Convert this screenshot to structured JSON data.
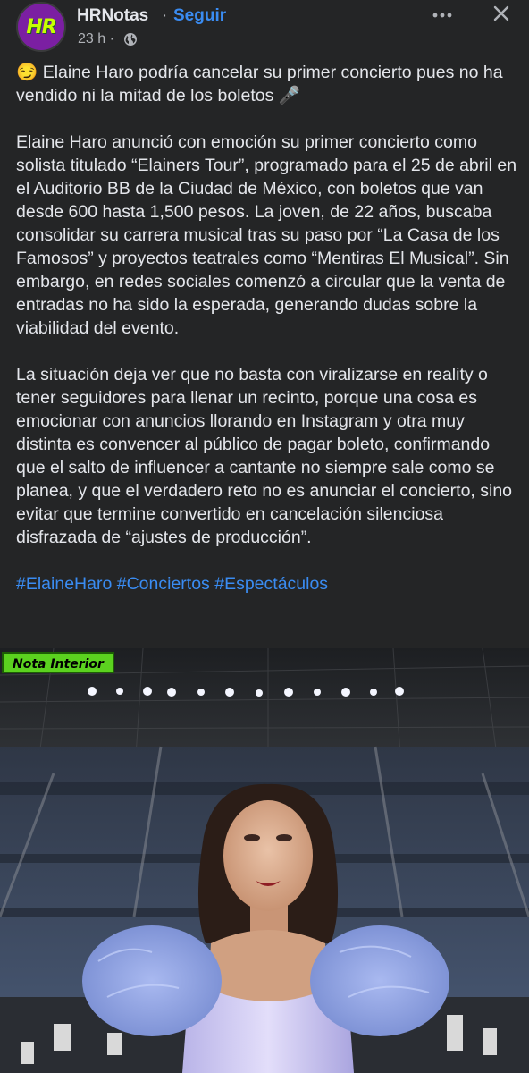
{
  "header": {
    "avatar_text": "HR",
    "page_name": "HRNotas",
    "separator": "·",
    "follow_label": "Seguir",
    "timestamp": "23 h ·",
    "privacy_icon": "globe-icon",
    "more_icon": "more-icon",
    "close_icon": "close-icon"
  },
  "post": {
    "headline": "😏 Elaine Haro podría cancelar su primer concierto pues no ha vendido ni la mitad de los boletos 🎤",
    "paragraph_1": "Elaine Haro anunció con emoción su primer concierto como solista titulado “Elainers Tour”, programado para el 25 de abril en el Auditorio BB de la Ciudad de México, con boletos que van desde 600 hasta 1,500 pesos. La joven, de 22 años, buscaba consolidar su carrera musical tras su paso por “La Casa de los Famosos” y proyectos teatrales como “Mentiras El Musical”. Sin embargo, en redes sociales comenzó a circular que la venta de entradas no ha sido la esperada, generando dudas sobre la viabilidad del evento.",
    "paragraph_2": "La situación deja ver que no basta con viralizarse en reality o tener seguidores para llenar un recinto, porque una cosa es emocionar con anuncios llorando en Instagram y otra muy distinta es convencer al público de pagar boleto, confirmando que el salto de influencer a cantante no siempre sale como se planea, y que el verdadero reto no es anunciar el concierto, sino evitar que termine convertido en cancelación silenciosa disfrazada de “ajustes de producción”.",
    "hashtags": [
      "#ElaineHaro",
      "#Conciertos",
      "#Espectáculos"
    ]
  },
  "image": {
    "badge_label": "Nota Interior"
  },
  "colors": {
    "background": "#242526",
    "text": "#e4e6eb",
    "secondary_text": "#b0b3b8",
    "link": "#3a8cf2",
    "badge": "#5bd21f",
    "avatar_bg": "#7b1fa2",
    "avatar_text": "#c6ff00"
  }
}
